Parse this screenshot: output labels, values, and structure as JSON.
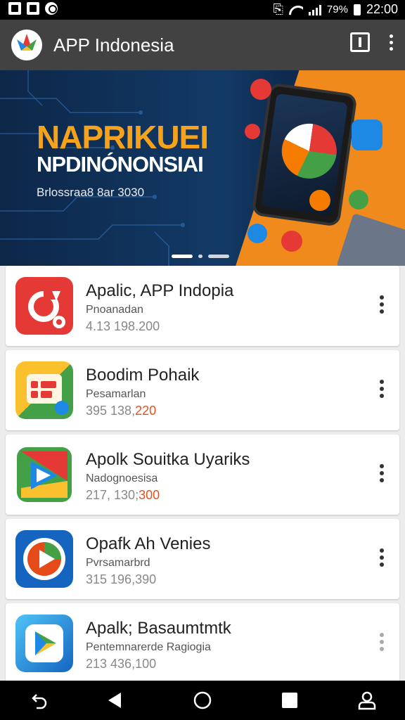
{
  "status_bar": {
    "time": "22:00",
    "battery": "79%",
    "left_icons": [
      "notification-icon",
      "document-icon",
      "pinterest-icon"
    ],
    "right_icons": [
      "vibrate-icon",
      "wifi-icon",
      "signal-icon",
      "battery-icon"
    ]
  },
  "app_bar": {
    "title": "APP Indonesia",
    "actions": [
      "book-icon",
      "more-vert-icon"
    ]
  },
  "banner": {
    "headline": "NAPRIKUEI",
    "subheadline": "NPDINÓNONSIAI",
    "tagline": "Brlossraa8 8ar 3030",
    "carousel_pages": 3,
    "active_page": 1
  },
  "apps": [
    {
      "name": "Apalic, APP Indopia",
      "subtitle": "Pnoanadan",
      "count": "4.13 198.200",
      "count_highlight": "",
      "icon": "refresh-icon",
      "colors": [
        "#e53935",
        "#c62828"
      ]
    },
    {
      "name": "Boodim Pohaik",
      "subtitle": "Pesamarlan",
      "count": "395 138,",
      "count_highlight": "220",
      "icon": "layout-grid-icon",
      "colors": [
        "#fbc02d",
        "#43a047"
      ]
    },
    {
      "name": "Apolk Souitka Uyariks",
      "subtitle": "Nadognoesisa",
      "count": "217, 130;",
      "count_highlight": "300",
      "icon": "play-store-icon",
      "colors": [
        "#f9a825",
        "#1e88e5"
      ]
    },
    {
      "name": "Opafk Ah Venies",
      "subtitle": "Pvrsamarbrd",
      "count": "315 196,390",
      "count_highlight": "",
      "icon": "play-circle-icon",
      "colors": [
        "#1565c0",
        "#e64a19"
      ]
    },
    {
      "name": "Apalk; Basaumtmtk",
      "subtitle": "Pentemnarerde Ragiogia",
      "count": "213 436,100",
      "count_highlight": "",
      "icon": "play-icon",
      "colors": [
        "#29b6f6",
        "#1565c0"
      ]
    }
  ],
  "nav_bar": {
    "buttons": [
      "undo-icon",
      "back-icon",
      "home-icon",
      "recents-icon",
      "account-icon"
    ]
  }
}
